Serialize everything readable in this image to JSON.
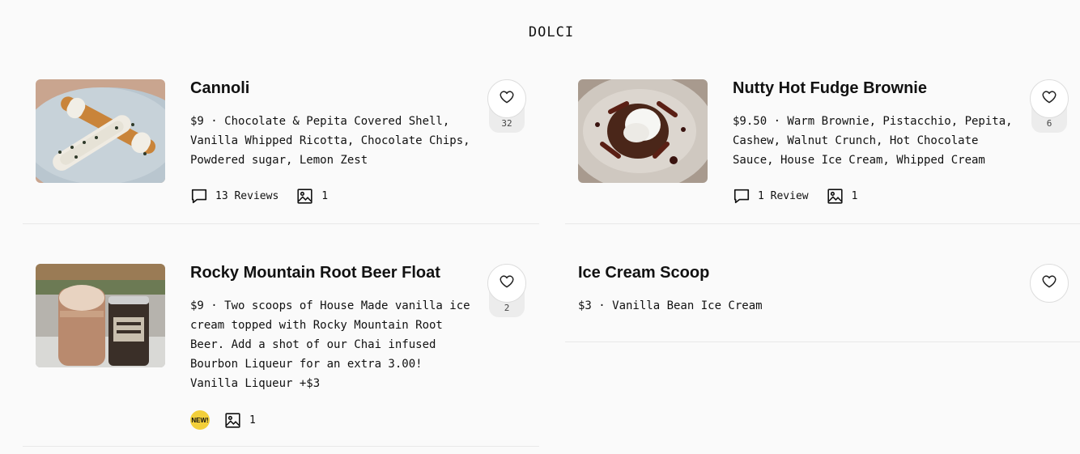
{
  "section": {
    "title": "DOLCI"
  },
  "items": [
    {
      "name": "Cannoli",
      "description": "$9 · Chocolate & Pepita Covered Shell, Vanilla Whipped Ricotta, Chocolate Chips, Powdered sugar, Lemon Zest",
      "reviews": "13 Reviews",
      "photos": "1",
      "likes": "32"
    },
    {
      "name": "Nutty Hot Fudge Brownie",
      "description": "$9.50 · Warm Brownie, Pistacchio, Pepita, Cashew, Walnut Crunch, Hot Chocolate Sauce, House Ice Cream, Whipped Cream",
      "reviews": "1 Review",
      "photos": "1",
      "likes": "6"
    },
    {
      "name": "Rocky Mountain Root Beer Float",
      "description_lines": [
        "$9 · Two scoops of House Made vanilla ice cream topped with Rocky Mountain Root Beer. Add a shot of our Chai infused Bourbon Liqueur for an extra 3.00!",
        "Vanilla Liqueur +$3"
      ],
      "badge": "NEW!",
      "photos": "1",
      "likes": "2"
    },
    {
      "name": "Ice Cream Scoop",
      "description": "$3 · Vanilla Bean Ice Cream"
    }
  ],
  "icons": {
    "heart": "heart-icon",
    "comment": "comment-icon",
    "photo": "photo-icon"
  }
}
